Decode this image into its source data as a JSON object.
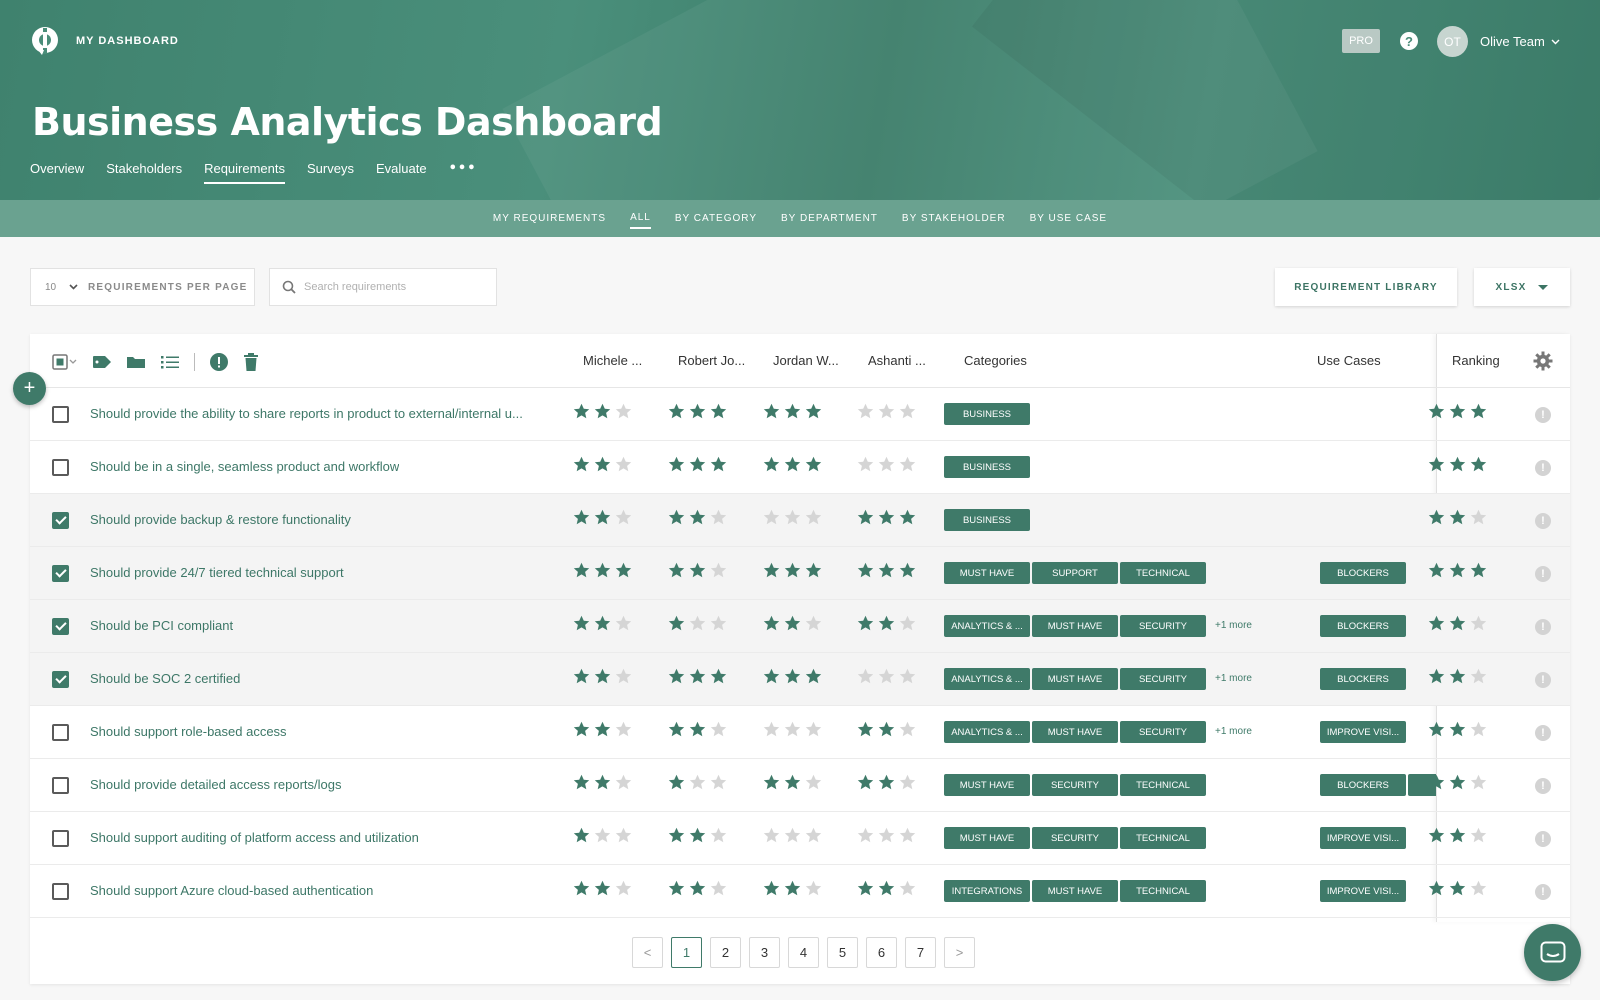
{
  "header": {
    "brand": "MY DASHBOARD",
    "plan_badge": "PRO",
    "help_glyph": "?",
    "avatar_initials": "OT",
    "user_name": "Olive Team",
    "title": "Business Analytics Dashboard",
    "tabs": [
      {
        "label": "Overview",
        "active": false
      },
      {
        "label": "Stakeholders",
        "active": false
      },
      {
        "label": "Requirements",
        "active": true
      },
      {
        "label": "Surveys",
        "active": false
      },
      {
        "label": "Evaluate",
        "active": false
      }
    ],
    "more_label": "•••"
  },
  "subnav": {
    "items": [
      {
        "label": "MY REQUIREMENTS",
        "active": false
      },
      {
        "label": "ALL",
        "active": true
      },
      {
        "label": "BY CATEGORY",
        "active": false
      },
      {
        "label": "BY DEPARTMENT",
        "active": false
      },
      {
        "label": "BY STAKEHOLDER",
        "active": false
      },
      {
        "label": "BY USE CASE",
        "active": false
      }
    ]
  },
  "toolbar": {
    "per_page_value": "10",
    "per_page_label": "REQUIREMENTS PER PAGE",
    "search_placeholder": "Search requirements",
    "library_button": "REQUIREMENT LIBRARY",
    "export_button": "XLSX"
  },
  "table": {
    "columns": {
      "stakeholder_1": "Michele ...",
      "stakeholder_2": "Robert Jo...",
      "stakeholder_3": "Jordan W...",
      "stakeholder_4": "Ashanti ...",
      "categories": "Categories",
      "use_cases": "Use Cases",
      "ranking": "Ranking"
    },
    "rows": [
      {
        "text": "Should provide the ability to share reports in product to external/internal u...",
        "checked": false,
        "ratings": [
          2,
          3,
          3,
          0
        ],
        "categories": [
          "BUSINESS"
        ],
        "more": "",
        "use_cases": [],
        "ranking": 3
      },
      {
        "text": "Should be in a single, seamless product and workflow",
        "checked": false,
        "ratings": [
          2,
          3,
          3,
          0
        ],
        "categories": [
          "BUSINESS"
        ],
        "more": "",
        "use_cases": [],
        "ranking": 3
      },
      {
        "text": "Should provide backup & restore functionality",
        "checked": true,
        "ratings": [
          2,
          2,
          0,
          3
        ],
        "categories": [
          "BUSINESS"
        ],
        "more": "",
        "use_cases": [],
        "ranking": 2
      },
      {
        "text": "Should provide 24/7 tiered technical support",
        "checked": true,
        "ratings": [
          3,
          2,
          3,
          3
        ],
        "categories": [
          "MUST HAVE",
          "SUPPORT",
          "TECHNICAL"
        ],
        "more": "",
        "use_cases": [
          "BLOCKERS"
        ],
        "ranking": 3
      },
      {
        "text": "Should be PCI compliant",
        "checked": true,
        "ratings": [
          2,
          1,
          2,
          2
        ],
        "categories": [
          "ANALYTICS & ...",
          "MUST HAVE",
          "SECURITY"
        ],
        "more": "+1 more",
        "use_cases": [
          "BLOCKERS"
        ],
        "ranking": 2
      },
      {
        "text": "Should be SOC 2 certified",
        "checked": true,
        "ratings": [
          2,
          3,
          3,
          0
        ],
        "categories": [
          "ANALYTICS & ...",
          "MUST HAVE",
          "SECURITY"
        ],
        "more": "+1 more",
        "use_cases": [
          "BLOCKERS"
        ],
        "ranking": 2
      },
      {
        "text": "Should support role-based access",
        "checked": false,
        "ratings": [
          2,
          2,
          0,
          2
        ],
        "categories": [
          "ANALYTICS & ...",
          "MUST HAVE",
          "SECURITY"
        ],
        "more": "+1 more",
        "use_cases": [
          "IMPROVE VISI..."
        ],
        "ranking": 2
      },
      {
        "text": "Should provide detailed access reports/logs",
        "checked": false,
        "ratings": [
          2,
          1,
          2,
          2
        ],
        "categories": [
          "MUST HAVE",
          "SECURITY",
          "TECHNICAL"
        ],
        "more": "",
        "use_cases": [
          "BLOCKERS",
          "IMPR"
        ],
        "ranking": 2
      },
      {
        "text": "Should support auditing of platform access and utilization",
        "checked": false,
        "ratings": [
          1,
          2,
          0,
          0
        ],
        "categories": [
          "MUST HAVE",
          "SECURITY",
          "TECHNICAL"
        ],
        "more": "",
        "use_cases": [
          "IMPROVE VISI..."
        ],
        "ranking": 2
      },
      {
        "text": "Should support Azure cloud-based authentication",
        "checked": false,
        "ratings": [
          2,
          2,
          2,
          2
        ],
        "categories": [
          "INTEGRATIONS",
          "MUST HAVE",
          "TECHNICAL"
        ],
        "more": "",
        "use_cases": [
          "IMPROVE VISI..."
        ],
        "ranking": 2
      }
    ],
    "info_glyph": "!"
  },
  "pagination": {
    "prev": "<",
    "next": ">",
    "pages": [
      "1",
      "2",
      "3",
      "4",
      "5",
      "6",
      "7"
    ],
    "current": "1"
  },
  "fab_add_label": "+",
  "colors": {
    "primary": "#3f7a69",
    "header_bg": "#4a8d79",
    "subnav_bg": "#6aa290",
    "star_filled": "#3f7a69",
    "star_empty": "#d5d5d5"
  },
  "icons": [
    "logo-icon",
    "help-icon",
    "chevron-down-icon",
    "search-icon",
    "tag-icon",
    "folder-icon",
    "list-icon",
    "alert-icon",
    "trash-icon",
    "gear-icon",
    "star-icon",
    "info-icon",
    "chat-icon"
  ]
}
